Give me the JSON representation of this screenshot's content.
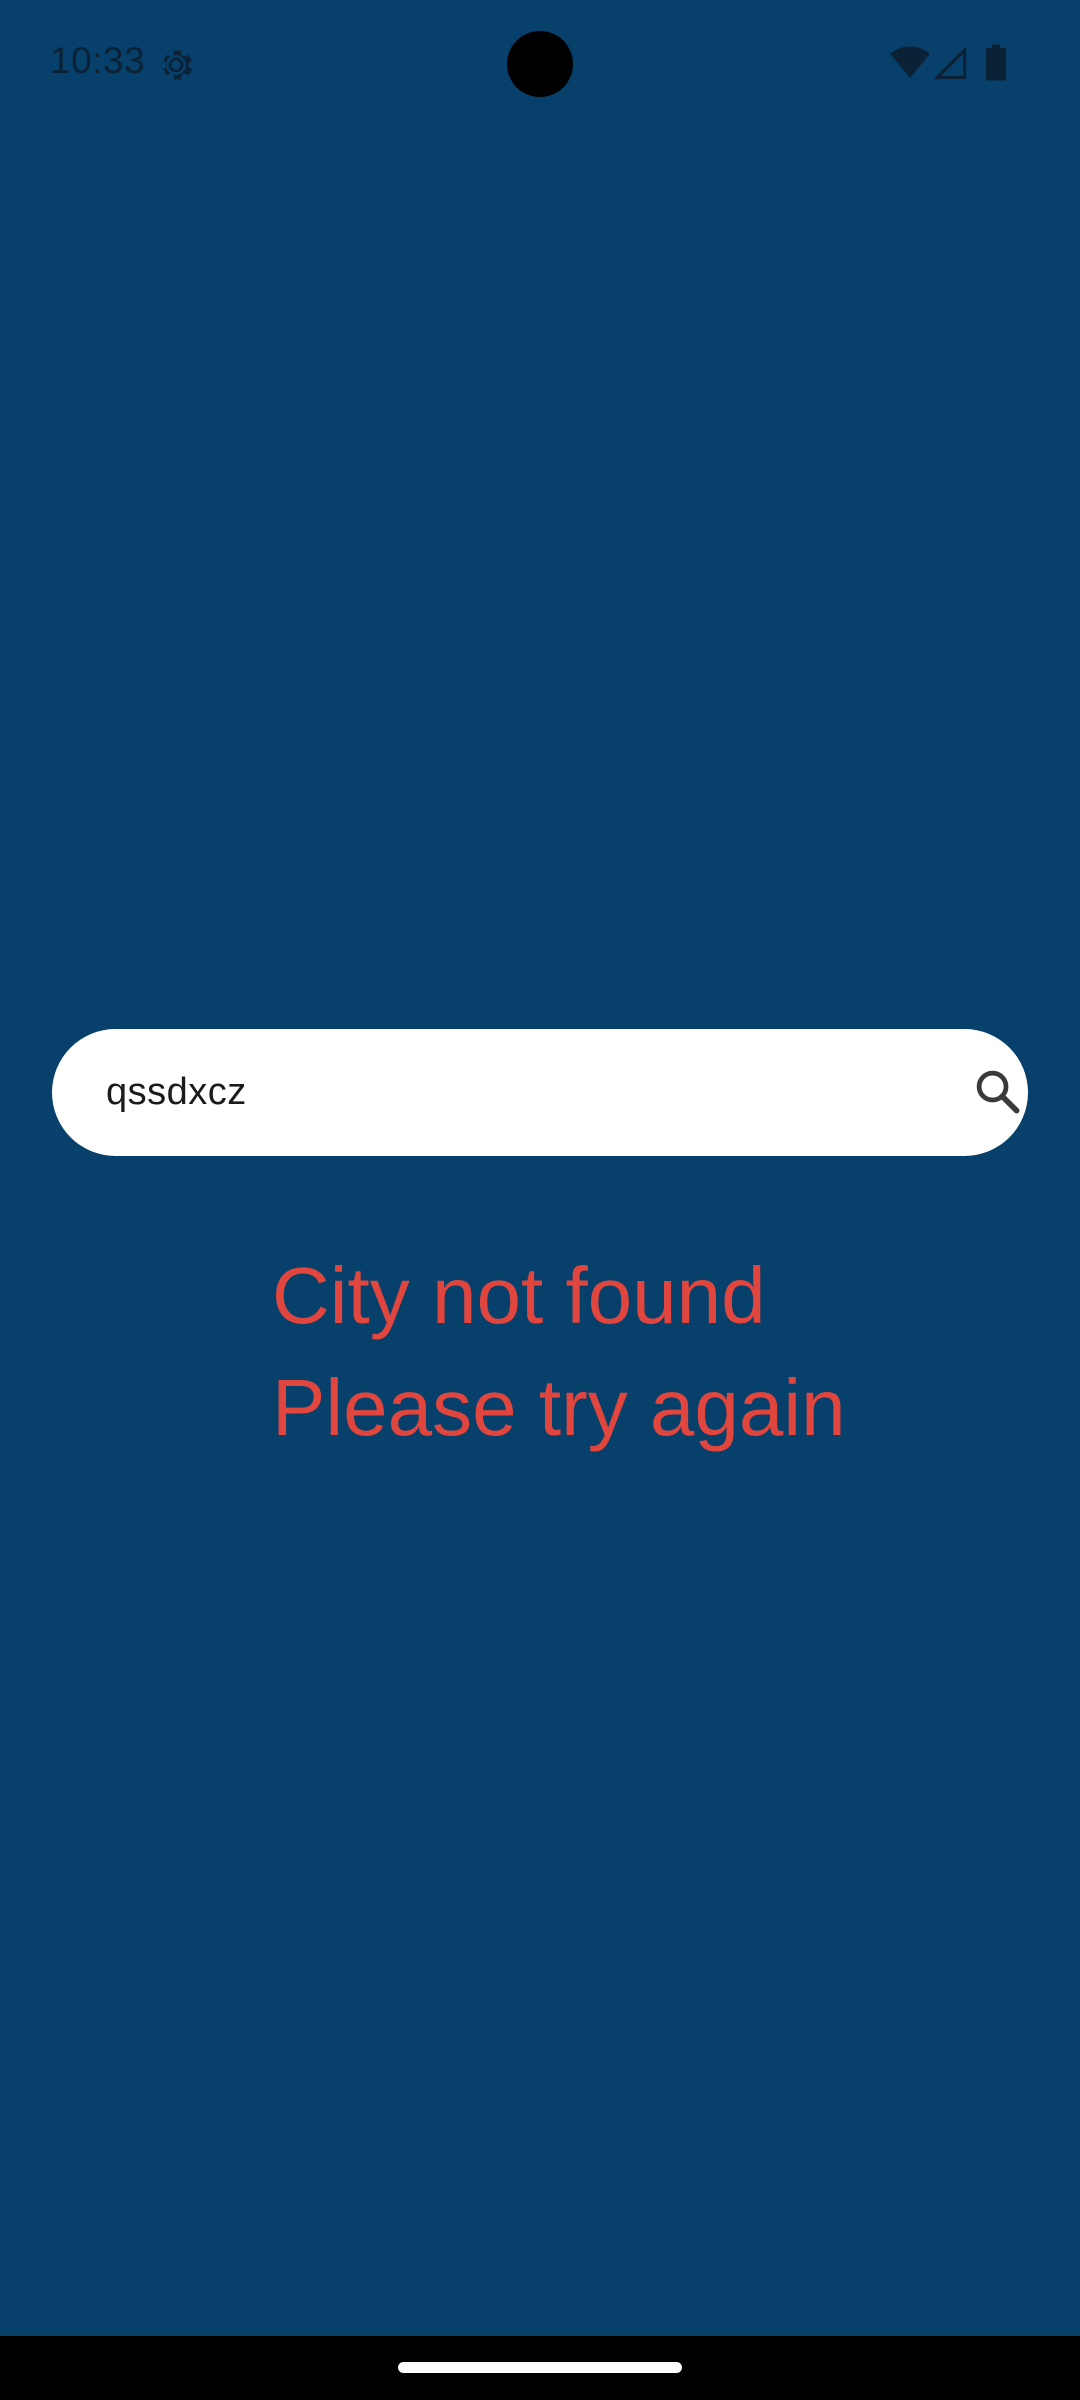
{
  "status_bar": {
    "time": "10:33",
    "icons": [
      "settings-gear-icon",
      "wifi-icon",
      "signal-icon",
      "battery-icon"
    ],
    "color": "#0b2236"
  },
  "search": {
    "value": "qssdxcz",
    "icon": "search-icon"
  },
  "error": {
    "line1": "City not found",
    "line2": "Please try again",
    "color": "#e0463e"
  },
  "theme": {
    "background": "#06406b",
    "search_background": "#ffffff"
  }
}
